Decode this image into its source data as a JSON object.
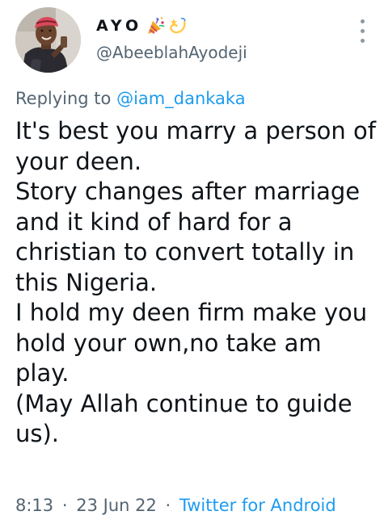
{
  "tweet": {
    "author": {
      "display_name": "AYO",
      "name_emojis": [
        "party-popper-icon",
        "dizzy-icon"
      ],
      "username": "@AbeeblahAyodeji"
    },
    "reply": {
      "prefix": "Replying to",
      "mention": "@iam_dankaka"
    },
    "text_lines": [
      "It's best you marry a person of",
      "your deen.",
      "Story changes after marriage",
      "and it kind of hard for a",
      "christian to convert totally in",
      "this Nigeria.",
      "I hold my deen firm make you",
      "hold your own,no take am",
      "play.",
      "(May Allah continue to guide",
      "us)."
    ],
    "time": "8:13",
    "date": "23 Jun 22",
    "separator": "·",
    "source": "Twitter for Android",
    "more_icon": "more-vertical-icon"
  },
  "colors": {
    "text": "#0f1419",
    "secondary": "#536471",
    "link": "#1d9bf0"
  }
}
